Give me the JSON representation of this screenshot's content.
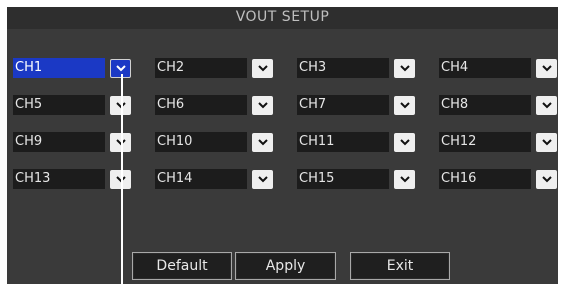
{
  "title": "VOUT SETUP",
  "channels": [
    {
      "label": "CH1"
    },
    {
      "label": "CH2"
    },
    {
      "label": "CH3"
    },
    {
      "label": "CH4"
    },
    {
      "label": "CH5"
    },
    {
      "label": "CH6"
    },
    {
      "label": "CH7"
    },
    {
      "label": "CH8"
    },
    {
      "label": "CH9"
    },
    {
      "label": "CH10"
    },
    {
      "label": "CH11"
    },
    {
      "label": "CH12"
    },
    {
      "label": "CH13"
    },
    {
      "label": "CH14"
    },
    {
      "label": "CH15"
    },
    {
      "label": "CH16"
    }
  ],
  "buttons": {
    "default_label": "Default",
    "apply_label": "Apply",
    "exit_label": "Exit"
  },
  "colors": {
    "dialog_bg": "#3a3a3a",
    "selected": "#1b39c5",
    "field_bg": "#1c1c1c"
  }
}
